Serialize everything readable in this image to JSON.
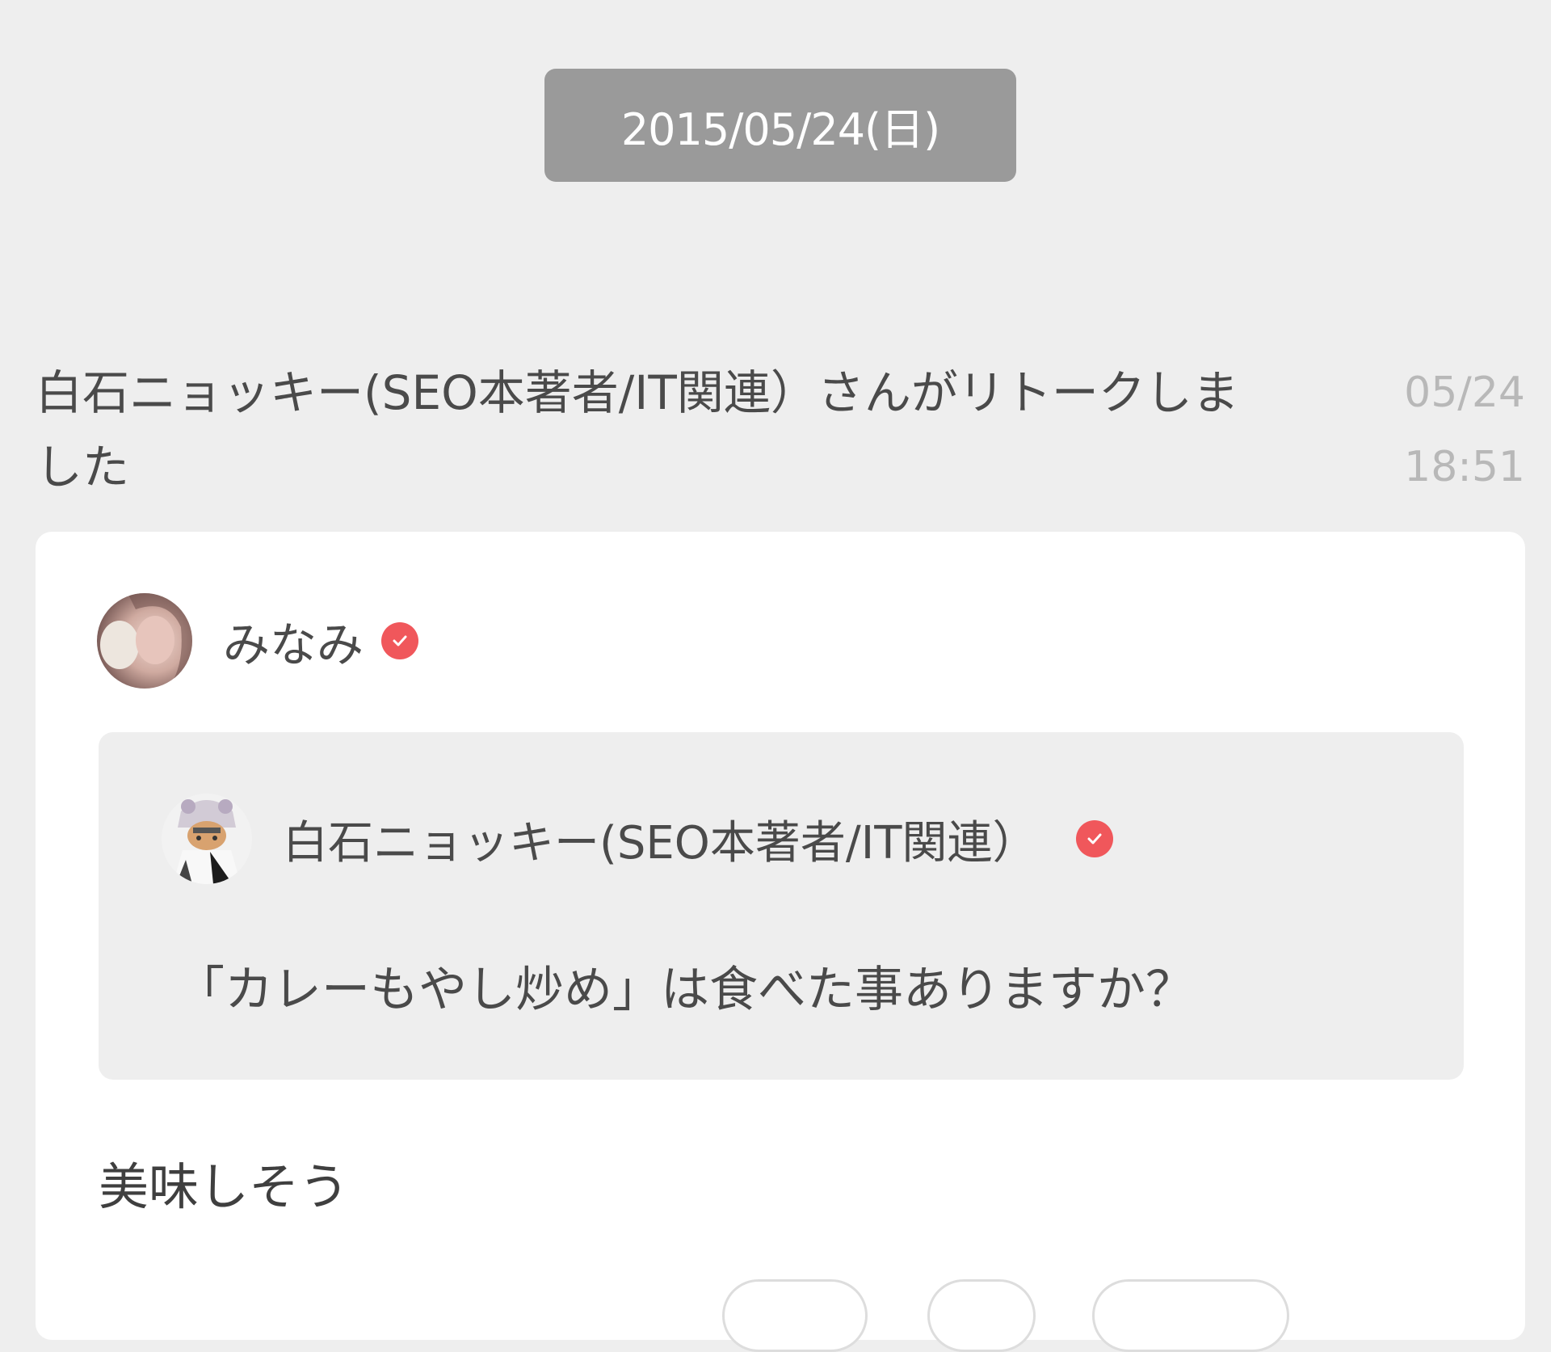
{
  "date_separator": "2015/05/24(日)",
  "retalk_notice": {
    "text": "白石ニョッキー(SEO本著者/IT関連）さんがリトークしました",
    "date": "05/24",
    "time": "18:51"
  },
  "post": {
    "author": "みなみ",
    "quoted": {
      "author": "白石ニョッキー(SEO本著者/IT関連）",
      "text": "「カレーもやし炒め」は食べた事ありますか？"
    },
    "comment": "美味しそう"
  },
  "colors": {
    "background": "#eeeeee",
    "date_pill": "#9a9a9a",
    "verified_badge": "#f0575b",
    "timestamp": "#b8b8b8"
  },
  "icons": {
    "avatar": "user-avatar-photo",
    "quote_avatar": "character-avatar",
    "verified": "verified-badge-icon"
  }
}
